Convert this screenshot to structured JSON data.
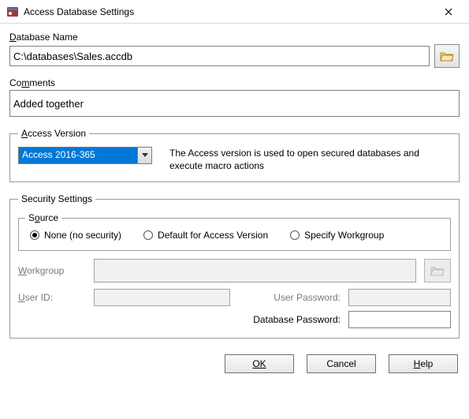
{
  "window": {
    "title": "Access Database Settings",
    "close": "✕"
  },
  "db": {
    "label_pre": "D",
    "label_post": "atabase Name",
    "value": "C:\\databases\\Sales.accdb"
  },
  "comments": {
    "label_pre": "Co",
    "label_u": "m",
    "label_post": "ments",
    "value": "Added together"
  },
  "version": {
    "legend_u": "A",
    "legend_post": "ccess Version",
    "selected": "Access 2016-365",
    "desc": "The Access version is used to open secured databases and execute macro actions"
  },
  "security": {
    "legend": "Security Settings",
    "source_pre": "S",
    "source_u": "o",
    "source_post": "urce",
    "options": {
      "none": "None (no security)",
      "default": "Default for Access Version",
      "specify": "Specify Workgroup"
    },
    "workgroup_u": "W",
    "workgroup_post": "orkgroup",
    "userid_u": "U",
    "userid_post": "ser ID:",
    "user_password": "User Password:",
    "db_password": "Database Password:"
  },
  "buttons": {
    "ok": "OK",
    "cancel": "Cancel",
    "help_u": "H",
    "help_post": "elp"
  }
}
